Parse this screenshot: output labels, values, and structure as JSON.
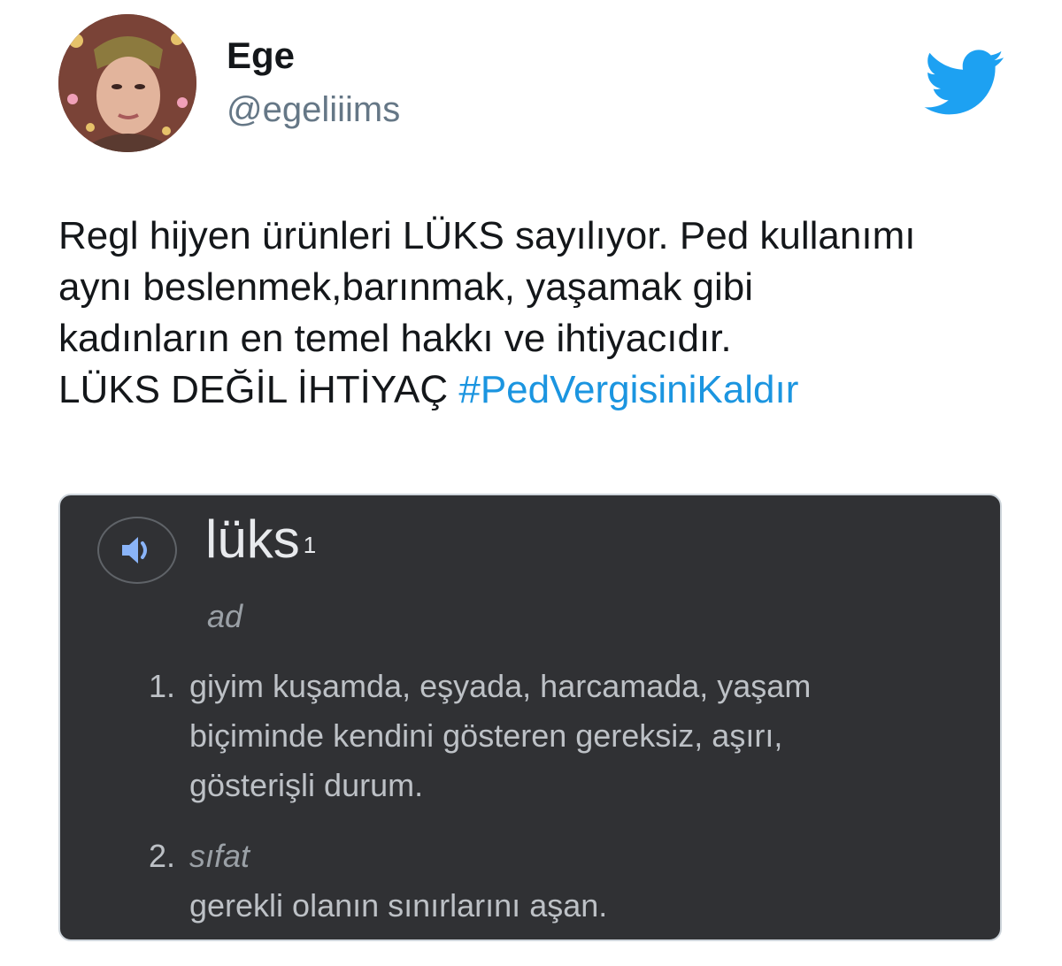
{
  "user": {
    "display_name": "Ege",
    "handle": "@egeliiims",
    "avatar_icon": "avatar-photo"
  },
  "brand": {
    "logo_icon": "twitter-bird-icon",
    "logo_color": "#1da1f2"
  },
  "tweet": {
    "lines": [
      "Regl hijyen ürünleri LÜKS sayılıyor. Ped kullanımı",
      "aynı beslenmek,barınmak, yaşamak gibi",
      "kadınların en temel hakkı ve ihtiyacıdır."
    ],
    "last_line_text": "LÜKS DEĞİL İHTİYAÇ",
    "hashtag": "#PedVergisiniKaldır",
    "hashtag_color": "#1b95e0"
  },
  "media": {
    "word": "lüks",
    "superscript": "1",
    "part_of_speech": "ad",
    "speaker_icon": "speaker-icon",
    "definitions": [
      {
        "number": "1.",
        "lines": [
          "giyim kuşamda, eşyada, harcamada, yaşam",
          "biçiminde kendini gösteren gereksiz, aşırı,",
          "gösterişli durum."
        ]
      },
      {
        "number": "2.",
        "tag": "sıfat",
        "lines": [
          "gerekli olanın sınırlarını aşan."
        ]
      }
    ],
    "background_color": "#303134"
  }
}
